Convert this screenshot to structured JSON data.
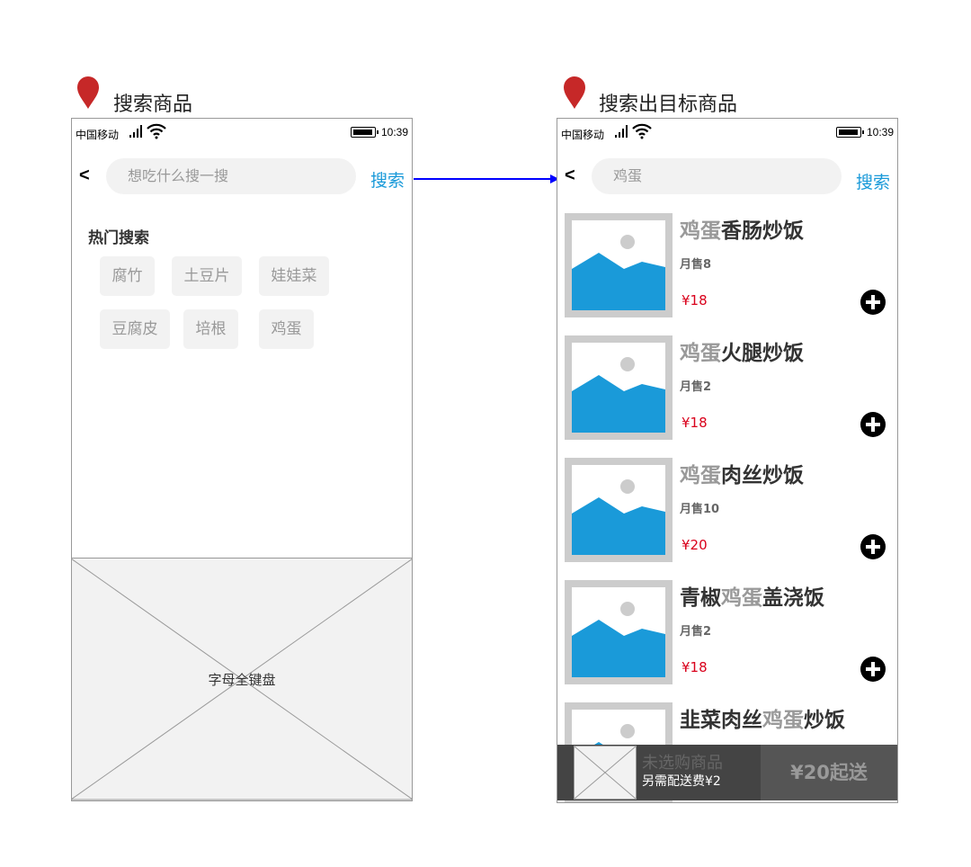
{
  "left_screen": {
    "title": "搜索商品",
    "status": {
      "carrier": "中国移动",
      "time": "10:39"
    },
    "back_label": "<",
    "search_placeholder": "想吃什么搜一搜",
    "search_button": "搜索",
    "hot_title": "热门搜索",
    "hot_tags": [
      "腐竹",
      "土豆片",
      "娃娃菜",
      "豆腐皮",
      "培根",
      "鸡蛋"
    ],
    "keyboard_label": "字母全键盘"
  },
  "right_screen": {
    "title": "搜索出目标商品",
    "status": {
      "carrier": "中国移动",
      "time": "10:39"
    },
    "back_label": "<",
    "search_value": "鸡蛋",
    "search_button": "搜索",
    "products": [
      {
        "name_pre": "",
        "name_hl": "鸡蛋",
        "name_post": "香肠炒饭",
        "sales": "月售8",
        "price": "¥18"
      },
      {
        "name_pre": "",
        "name_hl": "鸡蛋",
        "name_post": "火腿炒饭",
        "sales": "月售2",
        "price": "¥18"
      },
      {
        "name_pre": "",
        "name_hl": "鸡蛋",
        "name_post": "肉丝炒饭",
        "sales": "月售10",
        "price": "¥20"
      },
      {
        "name_pre": "青椒",
        "name_hl": "鸡蛋",
        "name_post": "盖浇饭",
        "sales": "月售2",
        "price": "¥18"
      },
      {
        "name_pre": "韭菜肉丝",
        "name_hl": "鸡蛋",
        "name_post": "炒饭",
        "sales": "",
        "price": ""
      }
    ],
    "cart": {
      "empty_text": "未选购商品",
      "delivery_fee": "另需配送费¥2",
      "min_order": "¥20起送"
    }
  },
  "colors": {
    "accent": "#1a9ad9",
    "price": "#d9001b",
    "pin": "#c62828",
    "arrow": "#0000ff"
  },
  "icons": [
    "map-pin-icon",
    "signal-icon",
    "wifi-icon",
    "battery-icon",
    "plus-circle-icon",
    "image-placeholder-icon"
  ]
}
